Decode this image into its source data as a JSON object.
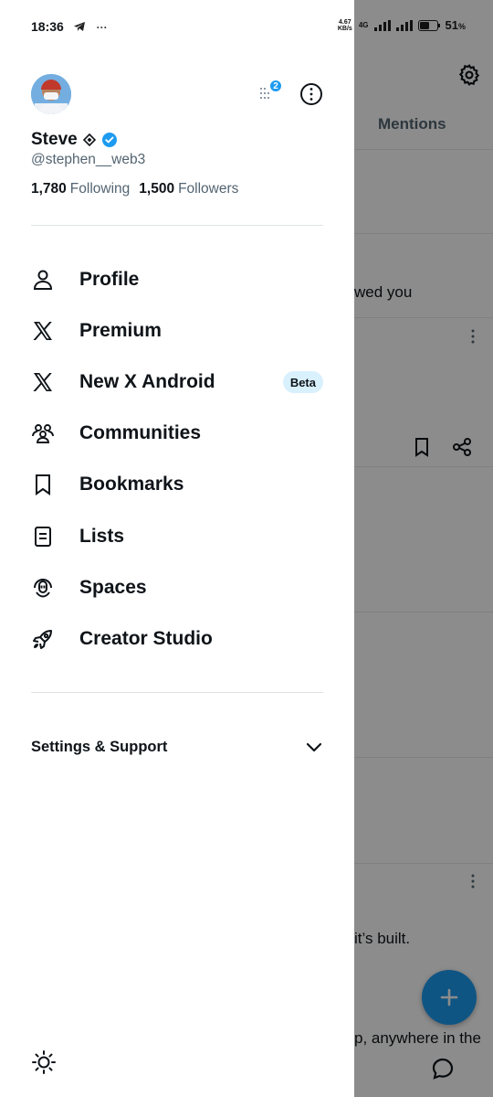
{
  "status_bar": {
    "time": "18:36",
    "network_speed": "4.67 KB/s",
    "network_type": "4G",
    "battery": "51"
  },
  "background": {
    "tab_mentions": "Mentions",
    "text_followed": "wed you",
    "text_built": "it’s built.",
    "text_anywhere": "p, anywhere in the"
  },
  "profile": {
    "name": "Steve",
    "handle": "@stephen__web3",
    "following_count": "1,780",
    "following_label": "Following",
    "followers_count": "1,500",
    "followers_label": "Followers",
    "account_badge_count": "2"
  },
  "menu": {
    "items": [
      {
        "label": "Profile",
        "icon": "person-icon"
      },
      {
        "label": "Premium",
        "icon": "x-logo-icon"
      },
      {
        "label": "New X Android",
        "icon": "x-logo-icon",
        "badge": "Beta"
      },
      {
        "label": "Communities",
        "icon": "communities-icon"
      },
      {
        "label": "Bookmarks",
        "icon": "bookmark-icon"
      },
      {
        "label": "Lists",
        "icon": "lists-icon"
      },
      {
        "label": "Spaces",
        "icon": "spaces-icon"
      },
      {
        "label": "Creator Studio",
        "icon": "rocket-icon"
      }
    ]
  },
  "settings": {
    "label": "Settings & Support"
  },
  "colors": {
    "accent": "#1d9bf0",
    "text": "#0f1419",
    "secondary_text": "#536471",
    "beta_bg": "#d9f0fd"
  }
}
